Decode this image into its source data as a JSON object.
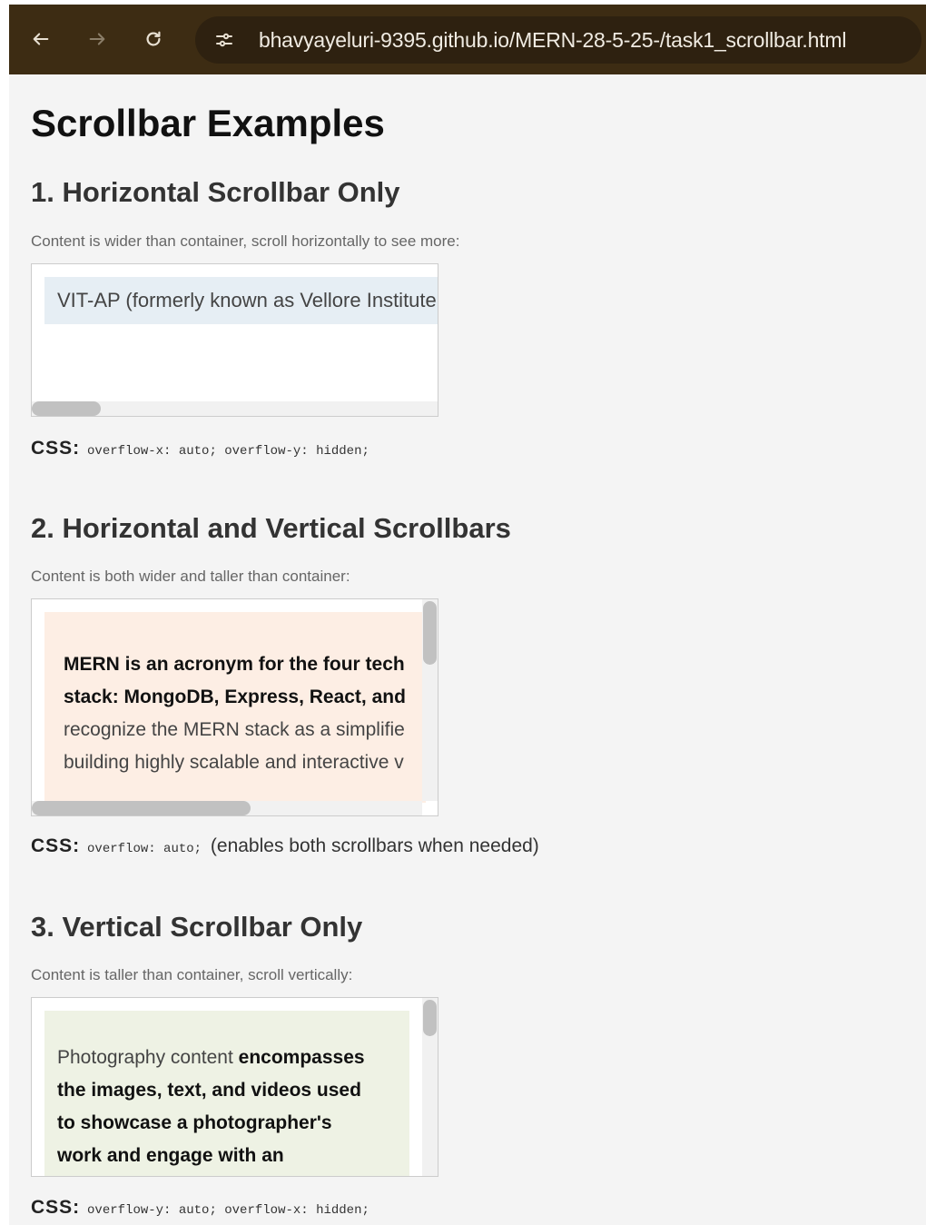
{
  "browser": {
    "url": "bhavyayeluri-9395.github.io/MERN-28-5-25-/task1_scrollbar.html",
    "icons": [
      "back-icon",
      "forward-icon",
      "reload-icon",
      "site-info-icon"
    ]
  },
  "page": {
    "title": "Scrollbar Examples"
  },
  "sections": [
    {
      "title": "1. Horizontal Scrollbar Only",
      "desc": "Content is wider than container, scroll horizontally to see more:",
      "content": "VIT-AP (formerly known as Vellore Institute",
      "css_label": "CSS:",
      "css_code": "overflow-x: auto; overflow-y: hidden;",
      "note": ""
    },
    {
      "title": "2. Horizontal and Vertical Scrollbars",
      "desc": "Content is both wider and taller than container:",
      "lines": [
        "MERN is an acronym for the four tech",
        "stack: MongoDB, Express, React, and",
        "recognize the MERN stack as a simplifie",
        "building highly scalable and interactive v"
      ],
      "css_label": "CSS:",
      "css_code": "overflow: auto;",
      "note": "(enables both scrollbars when needed)"
    },
    {
      "title": "3. Vertical Scrollbar Only",
      "desc": "Content is taller than container, scroll vertically:",
      "line1_normal": "Photography content ",
      "line1_bold": "encompasses",
      "lines": [
        "the images, text, and videos used",
        "to showcase a photographer's",
        "work and engage with an"
      ],
      "css_label": "CSS:",
      "css_code": "overflow-y: auto; overflow-x: hidden;",
      "note": ""
    }
  ],
  "colors": {
    "toolbar": "#3d2c13",
    "page_bg": "#f4f4f4",
    "box1_content_bg": "#e6eef4",
    "box2_content_bg": "#fdeee4",
    "box3_content_bg": "#eef2e4"
  }
}
